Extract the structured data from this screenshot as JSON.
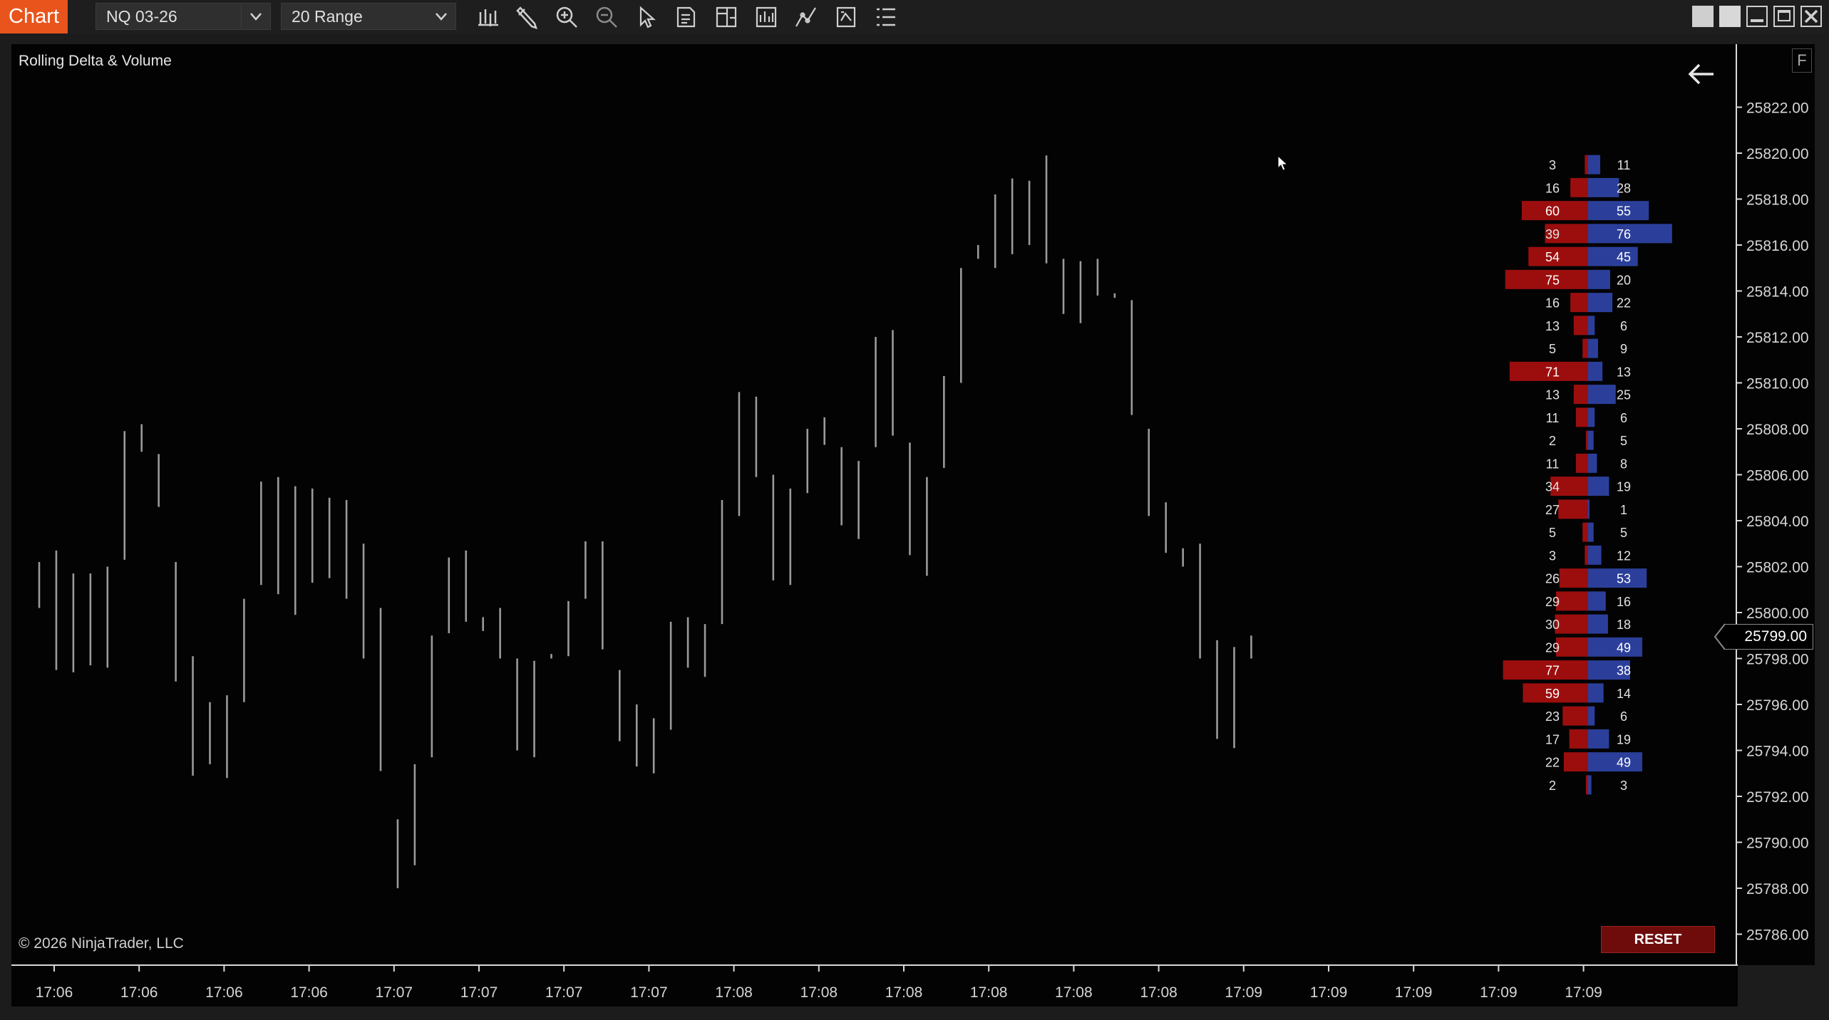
{
  "toolbar": {
    "chart_tab": "Chart",
    "instrument": "NQ 03-26",
    "bar_type": "20 Range",
    "icons": [
      "bar-type-icon",
      "drawing-tool-icon",
      "zoom-in-icon",
      "zoom-out-icon",
      "pointer-icon",
      "data-box-icon",
      "chart-trader-icon",
      "indicators-icon",
      "strategies-icon",
      "templates-icon",
      "properties-icon"
    ]
  },
  "window_controls": [
    "tile-icon",
    "restore-icon",
    "minimize-icon",
    "maximize-icon",
    "close-icon"
  ],
  "panel": {
    "title": "Rolling Delta & Volume",
    "copyright": "© 2026 NinjaTrader, LLC",
    "reset_label": "RESET",
    "f_label": "F"
  },
  "price_axis": {
    "labels": [
      "25822.00",
      "25820.00",
      "25818.00",
      "25816.00",
      "25814.00",
      "25812.00",
      "25810.00",
      "25808.00",
      "25806.00",
      "25804.00",
      "25802.00",
      "25800.00",
      "25798.00",
      "25796.00",
      "25794.00",
      "25792.00",
      "25790.00",
      "25788.00",
      "25786.00"
    ],
    "current_price": "25799.00"
  },
  "time_axis": {
    "labels": [
      "17:06",
      "17:06",
      "17:06",
      "17:06",
      "17:07",
      "17:07",
      "17:07",
      "17:07",
      "17:08",
      "17:08",
      "17:08",
      "17:08",
      "17:08",
      "17:08",
      "17:09",
      "17:09",
      "17:09",
      "17:09",
      "17:09"
    ]
  },
  "colors": {
    "sell": "#9c0e0e",
    "buy": "#2b3f9a",
    "bar": "#9a9a9a"
  },
  "chart_data": {
    "type": "bar",
    "bars": [
      [
        25802.2,
        25800.2
      ],
      [
        25802.7,
        25797.5
      ],
      [
        25801.7,
        25797.4
      ],
      [
        25801.7,
        25797.7
      ],
      [
        25802.0,
        25797.6
      ],
      [
        25807.9,
        25802.3
      ],
      [
        25808.2,
        25807.0
      ],
      [
        25806.9,
        25804.6
      ],
      [
        25802.2,
        25797.0
      ],
      [
        25798.1,
        25792.9
      ],
      [
        25796.1,
        25793.4
      ],
      [
        25796.4,
        25792.8
      ],
      [
        25800.6,
        25796.1
      ],
      [
        25805.7,
        25801.2
      ],
      [
        25805.9,
        25800.8
      ],
      [
        25805.5,
        25799.9
      ],
      [
        25805.4,
        25801.3
      ],
      [
        25805.0,
        25801.5
      ],
      [
        25804.9,
        25800.6
      ],
      [
        25803.0,
        25798.0
      ],
      [
        25800.2,
        25793.1
      ],
      [
        25788.0,
        25791.0
      ],
      [
        25793.4,
        25789.0
      ],
      [
        25799.0,
        25793.7
      ],
      [
        25802.4,
        25799.1
      ],
      [
        25802.7,
        25799.6
      ],
      [
        25799.8,
        25799.2
      ],
      [
        25800.2,
        25798.0
      ],
      [
        25798.0,
        25794.0
      ],
      [
        25797.9,
        25793.7
      ],
      [
        25798.2,
        25798.0
      ],
      [
        25800.5,
        25798.1
      ],
      [
        25803.1,
        25800.6
      ],
      [
        25803.1,
        25798.4
      ],
      [
        25797.5,
        25794.4
      ],
      [
        25796.0,
        25793.3
      ],
      [
        25795.4,
        25793.0
      ],
      [
        25799.6,
        25794.9
      ],
      [
        25799.8,
        25797.6
      ],
      [
        25799.5,
        25797.2
      ],
      [
        25804.9,
        25799.5
      ],
      [
        25809.6,
        25804.2
      ],
      [
        25809.4,
        25805.9
      ],
      [
        25806.0,
        25801.4
      ],
      [
        25805.4,
        25801.2
      ],
      [
        25808.0,
        25805.2
      ],
      [
        25808.5,
        25807.3
      ],
      [
        25807.2,
        25803.8
      ],
      [
        25806.6,
        25803.2
      ],
      [
        25812.0,
        25807.2
      ],
      [
        25812.3,
        25807.7
      ],
      [
        25807.4,
        25802.5
      ],
      [
        25805.9,
        25801.6
      ],
      [
        25810.3,
        25806.3
      ],
      [
        25815.0,
        25810.0
      ],
      [
        25816.0,
        25815.4
      ],
      [
        25818.2,
        25815.0
      ],
      [
        25818.9,
        25815.6
      ],
      [
        25818.8,
        25816.0
      ],
      [
        25819.9,
        25815.2
      ],
      [
        25815.4,
        25813.0
      ],
      [
        25815.3,
        25812.6
      ],
      [
        25815.4,
        25813.8
      ],
      [
        25813.9,
        25813.7
      ],
      [
        25813.6,
        25808.6
      ],
      [
        25808.0,
        25804.2
      ],
      [
        25804.8,
        25802.6
      ],
      [
        25802.8,
        25802.0
      ],
      [
        25803.0,
        25798.0
      ],
      [
        25798.8,
        25794.5
      ],
      [
        25798.5,
        25794.1
      ],
      [
        25799.0,
        25798.0
      ]
    ],
    "profile_prices": [
      25819.5,
      25818.5,
      25817.5,
      25816.5,
      25815.5,
      25814.5,
      25813.5,
      25812.5,
      25811.5,
      25810.5,
      25809.5,
      25808.5,
      25807.5,
      25806.5,
      25805.5,
      25804.5,
      25803.5,
      25802.5,
      25801.5,
      25800.5,
      25799.5,
      25798.5,
      25797.5,
      25796.5,
      25795.5,
      25794.5,
      25793.5,
      25792.5
    ],
    "sell": [
      3,
      16,
      60,
      39,
      54,
      75,
      16,
      13,
      5,
      71,
      13,
      11,
      2,
      11,
      34,
      27,
      5,
      3,
      26,
      29,
      30,
      29,
      77,
      59,
      23,
      17,
      22,
      2
    ],
    "buy": [
      11,
      28,
      55,
      76,
      45,
      20,
      22,
      6,
      9,
      13,
      25,
      6,
      5,
      8,
      19,
      1,
      5,
      12,
      53,
      16,
      18,
      49,
      38,
      14,
      6,
      19,
      49,
      3
    ],
    "highlight_sell": [
      2,
      4,
      5,
      9,
      22,
      23
    ],
    "highlight_buy": [
      2,
      3,
      4,
      18,
      21,
      22,
      26
    ],
    "ylim": [
      25784.5,
      25824.0
    ]
  }
}
